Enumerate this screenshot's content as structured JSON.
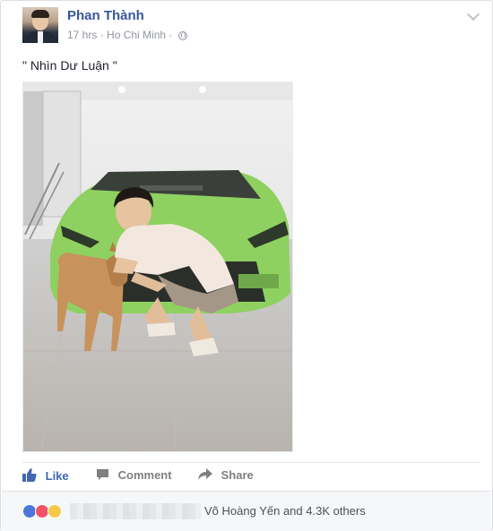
{
  "post": {
    "author": "Phan Thành",
    "time": "17 hrs",
    "separator": "·",
    "location": "Ho Chi Minh",
    "location_separator": "·",
    "text": "\" Nhìn Dư Luận \"",
    "privacy_icon": "globe-icon",
    "menu_icon": "chevron-down-icon"
  },
  "actions": {
    "like_label": "Like",
    "comment_label": "Comment",
    "share_label": "Share"
  },
  "reactions": {
    "icons": [
      "like",
      "love",
      "haha"
    ],
    "summary": "Võ Hoàng Yến and 4.3K others"
  },
  "colors": {
    "link_blue": "#365899",
    "like_blue": "#4267b2",
    "car_green": "#8ccf5f"
  }
}
